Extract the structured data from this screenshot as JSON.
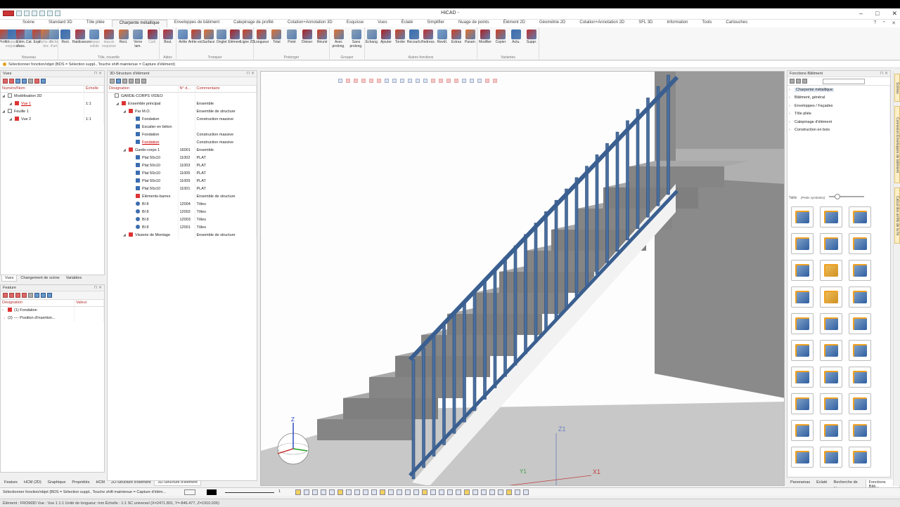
{
  "app": {
    "title": "HiCAD -",
    "window_controls": [
      "–",
      "□",
      "✕"
    ]
  },
  "menu_tabs": [
    "Scène",
    "Standard 3D",
    "Tôle pliée",
    "Charpente métallique",
    "Enveloppes de bâtiment",
    "Calepinage de profilé",
    "Cotation+Annotation 3D",
    "Esquisse",
    "Vues",
    "Éclaté",
    "Simplifier",
    "Nuage de points",
    "Élément 2D",
    "Géométrie 2D",
    "Cotation+Annotation 2D",
    "SFL 3D",
    "Information",
    "Tools",
    "Cartouches"
  ],
  "active_tab": "Charpente métallique",
  "ribbon": {
    "groups": [
      {
        "label": "Nouveau",
        "buttons": [
          "Profilé",
          "depuis esquisse",
          "Élém. d'ass.",
          "Cat.",
          "Expr.",
          "Fiche de doc",
          "Fiche d'art."
        ]
      },
      {
        "label": "Tôle, nouvelle",
        "buttons": [
          "Rect.",
          "Raidisseurs",
          "depuis solide",
          "depuis esquisse",
          "Rect.",
          "Verre lam.",
          "Caill."
        ]
      },
      {
        "label": "Aides",
        "buttons": [
          "Boul."
        ]
      },
      {
        "label": "Tronquer",
        "buttons": [
          "Arête",
          "Arête ext.",
          "Surface",
          "Onglet",
          "Élément",
          "Ligne 2D"
        ]
      },
      {
        "label": "Prolonger",
        "buttons": [
          "Longueur",
          "Total",
          "Point",
          "Diviser",
          "Réunir"
        ]
      },
      {
        "label": "Grouper",
        "buttons": [
          "Avec prolong.",
          "Sans prolong."
        ]
      },
      {
        "label": "Autres fonctions",
        "buttons": [
          "Échang.",
          "Ajouter",
          "Tordre",
          "Recourb.",
          "Redress.",
          "Revêt.",
          "Extras",
          "Param."
        ]
      },
      {
        "label": "Variantes",
        "buttons": [
          "Modifier",
          "Copier",
          "Actu.",
          "Suppr."
        ]
      }
    ]
  },
  "statusline": "Sélectionner fonction/objet (BDS = Sélection suppl., Touche shift maintenue = Capture d'élément)",
  "views_panel": {
    "title": "Vues",
    "columns": [
      "Numéro/Nom",
      "Échelle"
    ],
    "rows": [
      {
        "name": "Modélisation 3D",
        "scale": "",
        "level": 0
      },
      {
        "name": "Vue 1",
        "scale": "1:1",
        "level": 1,
        "link": true
      },
      {
        "name": "Feuille 1",
        "scale": "",
        "level": 0
      },
      {
        "name": "Vue 2",
        "scale": "1:1",
        "level": 1
      }
    ],
    "tabs": [
      "Vues",
      "Changement de scène",
      "Variables"
    ]
  },
  "feature_panel": {
    "title": "Feature",
    "columns": [
      "Désignation",
      "Valeur"
    ],
    "rows": [
      "(1) Fondation",
      "(2) ---- Position d'insertion..."
    ],
    "tabs": [
      "Feature",
      "HCM (2D)",
      "Graphique",
      "Propriétés",
      "HCM",
      "2D-Structure d'élément",
      "3D-Structure d'élément"
    ],
    "active_tab": "3D-Structure d'élément"
  },
  "structure_panel": {
    "title": "3D-Structure d'élément",
    "columns": [
      "Désignation",
      "N° d...",
      "Commentaire"
    ],
    "rows": [
      {
        "name": "GARDE-CORPS VIDEO",
        "num": "",
        "comment": "",
        "level": 0,
        "icon": "tree"
      },
      {
        "name": "Ensemble principal",
        "num": "",
        "comment": "Ensemble",
        "level": 1,
        "icon": "red"
      },
      {
        "name": "Par M.O.",
        "num": "",
        "comment": "Ensemble de structure",
        "level": 2,
        "icon": "red"
      },
      {
        "name": "Fondation",
        "num": "",
        "comment": "Construction massive",
        "level": 3,
        "icon": "blu"
      },
      {
        "name": "Escalier en béton",
        "num": "",
        "comment": "",
        "level": 3,
        "icon": "blu"
      },
      {
        "name": "Fondation",
        "num": "",
        "comment": "Construction massive",
        "level": 3,
        "icon": "blu"
      },
      {
        "name": "Fondation",
        "num": "",
        "comment": "Construction massive",
        "level": 3,
        "icon": "blu",
        "link": true
      },
      {
        "name": "Garde-corps 1",
        "num": "16001",
        "comment": "Ensemble",
        "level": 2,
        "icon": "red"
      },
      {
        "name": "Plat 50x10",
        "num": "11002",
        "comment": "PLAT",
        "level": 3,
        "icon": "blu"
      },
      {
        "name": "Plat 50x10",
        "num": "11003",
        "comment": "PLAT",
        "level": 3,
        "icon": "blu"
      },
      {
        "name": "Plat 50x10",
        "num": "11005",
        "comment": "PLAT",
        "level": 3,
        "icon": "blu"
      },
      {
        "name": "Plat 50x10",
        "num": "11009",
        "comment": "PLAT",
        "level": 3,
        "icon": "blu"
      },
      {
        "name": "Plat 50x10",
        "num": "11001",
        "comment": "PLAT",
        "level": 3,
        "icon": "blu"
      },
      {
        "name": "Éléments-barres",
        "num": "",
        "comment": "Ensemble de structure",
        "level": 3,
        "icon": "red"
      },
      {
        "name": "Bl 8",
        "num": "12004",
        "comment": "Tôles",
        "level": 3,
        "icon": "cir"
      },
      {
        "name": "Bl 8",
        "num": "12002",
        "comment": "Tôles",
        "level": 3,
        "icon": "cir"
      },
      {
        "name": "Bl 8",
        "num": "12003",
        "comment": "Tôles",
        "level": 3,
        "icon": "cir"
      },
      {
        "name": "Bl 8",
        "num": "12001",
        "comment": "Tôles",
        "level": 3,
        "icon": "cir"
      },
      {
        "name": "Visserie de Montage",
        "num": "",
        "comment": "Ensemble de structure",
        "level": 2,
        "icon": "red"
      }
    ]
  },
  "functions_panel": {
    "title": "Fonctions Bâtiment",
    "items": [
      "Charpente métallique",
      "Bâtiment, général",
      "Enveloppes / Façades",
      "Tôle pliée",
      "Calepinage d'élément",
      "Construction en bois"
    ],
    "size_label": "Taille",
    "size_hint": "(Petits symboles)",
    "tabs": [
      "Panoramas",
      "Éclaté",
      "Recherche de ...",
      "Fonctions Bâti..."
    ]
  },
  "right_sidebar_tabs": [
    "Scènes",
    "Connexion Enveloppes de bâtiment",
    "Calcul des arrêts de la fin"
  ],
  "viewport": {
    "axis_labels": [
      "Z1",
      "X1",
      "Y1",
      "Z"
    ]
  },
  "command_bar": "Sélectionner fonction/objet (BDS = Sélection suppl., Touche shift maintenue = Capture d'élém...",
  "command_bar_value": "1",
  "status_bar": "Élément : FROM3D  Vue : Vue 1 1:1  Unité de longueur: mm  Échelle : 1:1  SC universel (X=2471.801, Y=-846.477, Z=1910.026)",
  "colors": {
    "accent": "#2f5fa0",
    "concrete": "#8c8c8c",
    "railing": "#4a6f9f"
  }
}
